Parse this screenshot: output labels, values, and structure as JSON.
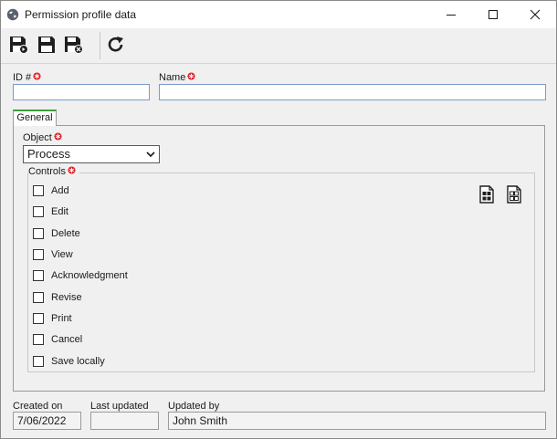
{
  "window": {
    "title": "Permission profile data",
    "buttons": [
      "minimize-icon",
      "maximize-icon",
      "close-icon"
    ]
  },
  "toolbar": {
    "buttons": [
      {
        "name": "save-and-new-button",
        "icon": "save-new-icon"
      },
      {
        "name": "save-button",
        "icon": "save-icon"
      },
      {
        "name": "save-and-close-button",
        "icon": "save-close-icon"
      },
      {
        "name": "refresh-button",
        "icon": "refresh-icon"
      }
    ]
  },
  "form": {
    "id_label": "ID #",
    "id_value": "",
    "name_label": "Name",
    "name_value": ""
  },
  "tabs": [
    {
      "label": "General",
      "active": true
    }
  ],
  "general": {
    "object_label": "Object",
    "object_value": "Process",
    "controls_label": "Controls",
    "controls": [
      {
        "label": "Add",
        "checked": false
      },
      {
        "label": "Edit",
        "checked": false
      },
      {
        "label": "Delete",
        "checked": false
      },
      {
        "label": "View",
        "checked": false
      },
      {
        "label": "Acknowledgment",
        "checked": false
      },
      {
        "label": "Revise",
        "checked": false
      },
      {
        "label": "Print",
        "checked": false
      },
      {
        "label": "Cancel",
        "checked": false
      },
      {
        "label": "Save locally",
        "checked": false
      }
    ]
  },
  "footer": {
    "created_on_label": "Created on",
    "created_on_value": "7/06/2022",
    "last_updated_label": "Last updated",
    "last_updated_value": "",
    "updated_by_label": "Updated by",
    "updated_by_value": "John Smith"
  },
  "colors": {
    "required": "#e0202a",
    "tab_accent": "#3f9e3f",
    "field_border": "#7a9cc6"
  }
}
